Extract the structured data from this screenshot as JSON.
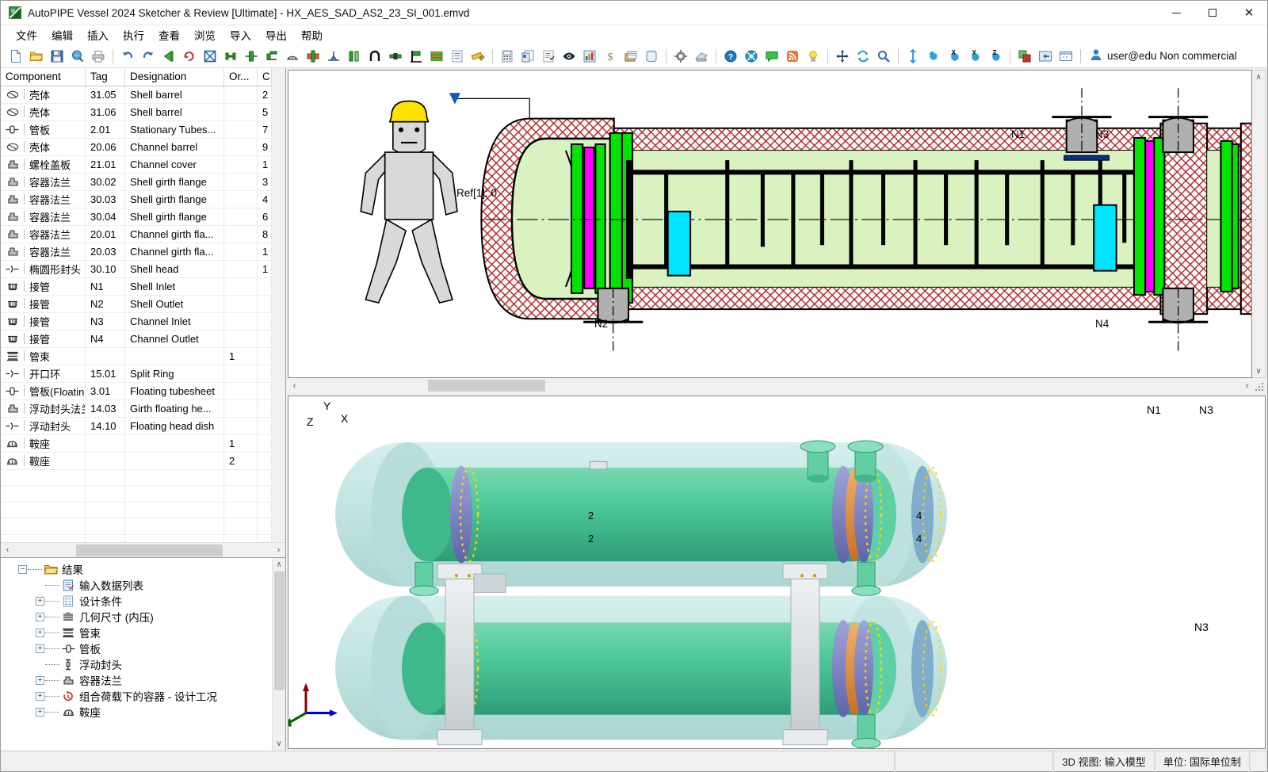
{
  "window": {
    "title": "AutoPIPE Vessel 2024 Sketcher & Review [Ultimate] - HX_AES_SAD_AS2_23_SI_001.emvd",
    "app_icon": "autopipe-vessel-icon",
    "minimize": "—",
    "maximize": "□",
    "close": "✕"
  },
  "menu": {
    "items": [
      {
        "label": "文件"
      },
      {
        "label": "编辑"
      },
      {
        "label": "插入"
      },
      {
        "label": "执行"
      },
      {
        "label": "查看"
      },
      {
        "label": "浏览"
      },
      {
        "label": "导入"
      },
      {
        "label": "导出"
      },
      {
        "label": "帮助"
      }
    ]
  },
  "toolbar": {
    "groups": [
      [
        "new-file-icon",
        "open-folder-icon",
        "save-disk-icon",
        "print-preview-icon",
        "print-icon"
      ],
      [
        "undo-icon",
        "redo-icon",
        "previous-icon",
        "refresh-cycle-icon",
        "grid-cross-icon",
        "shell-barrel-icon",
        "tubesheet-icon",
        "flange-icon",
        "saddle-icon",
        "nozzle-icon",
        "support-leg-icon"
      ],
      [
        "nozzle-green-icon",
        "support-leg-blue-icon",
        "channel-icon",
        "bend-icon",
        "lug-icon",
        "bracket-icon",
        "tube-bundle-icon",
        "data-list-icon",
        "ruler-edit-icon"
      ],
      [
        "calculator-icon",
        "report-icon",
        "checklist-icon",
        "eye-view-icon",
        "chart-icon",
        "cost-dollar-icon",
        "archive-icon",
        "database-icon"
      ],
      [
        "settings-gear-icon",
        "export-print-icon"
      ],
      [
        "help-question-icon",
        "lifebuoy-icon",
        "comment-icon",
        "rss-feed-icon",
        "tip-bulb-icon"
      ],
      [
        "pan-move-icon",
        "rotate-sync-icon",
        "zoom-magnifier-icon"
      ],
      [
        "fit-vertical-icon",
        "rotate-view-icon",
        "rotate-x-icon",
        "rotate-y-icon",
        "rotate-z-icon"
      ],
      [
        "render-mode-icon",
        "back-arrow-icon",
        "window-view-icon"
      ]
    ],
    "user_icon": "user-avatar-icon",
    "user_label": "user@edu Non commercial"
  },
  "component_grid": {
    "columns": [
      {
        "key": "component",
        "label": "Component"
      },
      {
        "key": "tag",
        "label": "Tag"
      },
      {
        "key": "designation",
        "label": "Designation"
      },
      {
        "key": "orient",
        "label": "Or..."
      },
      {
        "key": "extra",
        "label": "C"
      }
    ],
    "rows": [
      {
        "icon": "shell-barrel-icon",
        "component": "壳体",
        "tag": "31.05",
        "designation": "Shell barrel",
        "orient": "",
        "extra": "2"
      },
      {
        "icon": "shell-barrel-icon",
        "component": "壳体",
        "tag": "31.06",
        "designation": "Shell barrel",
        "orient": "",
        "extra": "5"
      },
      {
        "icon": "tubesheet-icon",
        "component": "管板",
        "tag": "2.01",
        "designation": "Stationary Tubes...",
        "orient": "",
        "extra": "7"
      },
      {
        "icon": "shell-barrel-icon",
        "component": "壳体",
        "tag": "20.06",
        "designation": "Channel barrel",
        "orient": "",
        "extra": "9"
      },
      {
        "icon": "flange-icon",
        "component": "螺栓盖板",
        "tag": "21.01",
        "designation": "Channel cover",
        "orient": "",
        "extra": "1"
      },
      {
        "icon": "flange-icon",
        "component": "容器法兰",
        "tag": "30.02",
        "designation": "Shell girth flange",
        "orient": "",
        "extra": "3"
      },
      {
        "icon": "flange-icon",
        "component": "容器法兰",
        "tag": "30.03",
        "designation": "Shell girth flange",
        "orient": "",
        "extra": "4"
      },
      {
        "icon": "flange-icon",
        "component": "容器法兰",
        "tag": "30.04",
        "designation": "Shell girth flange",
        "orient": "",
        "extra": "6"
      },
      {
        "icon": "flange-icon",
        "component": "容器法兰",
        "tag": "20.01",
        "designation": "Channel girth fla...",
        "orient": "",
        "extra": "8"
      },
      {
        "icon": "flange-icon",
        "component": "容器法兰",
        "tag": "20.03",
        "designation": "Channel girth fla...",
        "orient": "",
        "extra": "1"
      },
      {
        "icon": "head-icon",
        "component": "椭圆形封头",
        "tag": "30.10",
        "designation": "Shell head",
        "orient": "",
        "extra": "1"
      },
      {
        "icon": "nozzle-icon",
        "component": "接管",
        "tag": "N1",
        "designation": "Shell Inlet",
        "orient": "",
        "extra": ""
      },
      {
        "icon": "nozzle-icon",
        "component": "接管",
        "tag": "N2",
        "designation": "Shell Outlet",
        "orient": "",
        "extra": ""
      },
      {
        "icon": "nozzle-icon",
        "component": "接管",
        "tag": "N3",
        "designation": "Channel Inlet",
        "orient": "",
        "extra": ""
      },
      {
        "icon": "nozzle-icon",
        "component": "接管",
        "tag": "N4",
        "designation": "Channel Outlet",
        "orient": "",
        "extra": ""
      },
      {
        "icon": "tube-bundle-icon",
        "component": "管束",
        "tag": "",
        "designation": "",
        "orient": "1",
        "extra": ""
      },
      {
        "icon": "head-icon",
        "component": "开口环",
        "tag": "15.01",
        "designation": "Split Ring",
        "orient": "",
        "extra": ""
      },
      {
        "icon": "tubesheet-icon",
        "component": "管板(Floating)",
        "tag": "3.01",
        "designation": "Floating tubesheet",
        "orient": "",
        "extra": ""
      },
      {
        "icon": "flange-icon",
        "component": "浮动封头法兰",
        "tag": "14.03",
        "designation": "Girth floating he...",
        "orient": "",
        "extra": ""
      },
      {
        "icon": "head-icon",
        "component": "浮动封头",
        "tag": "14.10",
        "designation": "Floating head dish",
        "orient": "",
        "extra": ""
      },
      {
        "icon": "saddle-icon",
        "component": "鞍座",
        "tag": "",
        "designation": "",
        "orient": "1",
        "extra": ""
      },
      {
        "icon": "saddle-icon",
        "component": "鞍座",
        "tag": "",
        "designation": "",
        "orient": "2",
        "extra": ""
      }
    ]
  },
  "tree": {
    "root": {
      "label": "结果",
      "icon": "folder-open-icon",
      "expander": "−"
    },
    "items": [
      {
        "label": "输入数据列表",
        "icon": "input-data-list-icon",
        "expander": ""
      },
      {
        "label": "设计条件",
        "icon": "design-conditions-icon",
        "expander": "+"
      },
      {
        "label": "几何尺寸 (内压)",
        "icon": "geometry-icon",
        "expander": "+"
      },
      {
        "label": "管束",
        "icon": "tube-bundle-icon",
        "expander": "+"
      },
      {
        "label": "管板",
        "icon": "tubesheet-icon",
        "expander": "+"
      },
      {
        "label": "浮动封头",
        "icon": "floating-head-icon",
        "expander": ""
      },
      {
        "label": "容器法兰",
        "icon": "flange-icon",
        "expander": "+"
      },
      {
        "label": "组合荷载下的容器 - 设计工况",
        "icon": "combined-load-icon",
        "expander": "+"
      },
      {
        "label": "鞍座",
        "icon": "saddle-icon",
        "expander": "+"
      }
    ]
  },
  "view_2d": {
    "reference_label": "Ref[1]: 0",
    "reference_marker": "reference-triangle-icon",
    "mannequin": "human-scale-figure-icon",
    "nozzle_labels": [
      {
        "name": "N1"
      },
      {
        "name": "N2"
      },
      {
        "name": "N3"
      },
      {
        "name": "N4"
      }
    ],
    "colors": {
      "hatch": "#b22222",
      "shell_fill": "#d9f2bf",
      "flange": "#00e400",
      "gasket": "#ff00ff",
      "baffle": "#000000",
      "saddle": "#00e5ff",
      "nozzle": "#b0b0b0",
      "helmet": "#ffe100"
    }
  },
  "view_3d": {
    "nozzle_labels": [
      {
        "name": "N1"
      },
      {
        "name": "N3"
      },
      {
        "name": "N3",
        "pos": "bottom"
      }
    ],
    "saddle_markers": [
      "2",
      "2",
      "4",
      "4"
    ],
    "axis": {
      "x": "X",
      "y": "Y",
      "z": "Z",
      "x_color": "#0000cc",
      "y_color": "#8b0000",
      "z_color": "#006400"
    },
    "colors": {
      "vessel": "#4ec99a",
      "shell_ghost": "#aee0dd",
      "flange_ring": "#7b7fc4",
      "bolt": "#ffd400",
      "saddle": "#d8dde0",
      "gasket": "#e08a3c"
    }
  },
  "statusbar": {
    "left": "",
    "view_mode": "3D 视图: 输入模型",
    "units": "单位: 国际单位制",
    "right": ""
  },
  "scrollbars": {
    "left_arrow": "‹",
    "right_arrow": "›",
    "up_arrow": "∧",
    "down_arrow": "∨"
  }
}
